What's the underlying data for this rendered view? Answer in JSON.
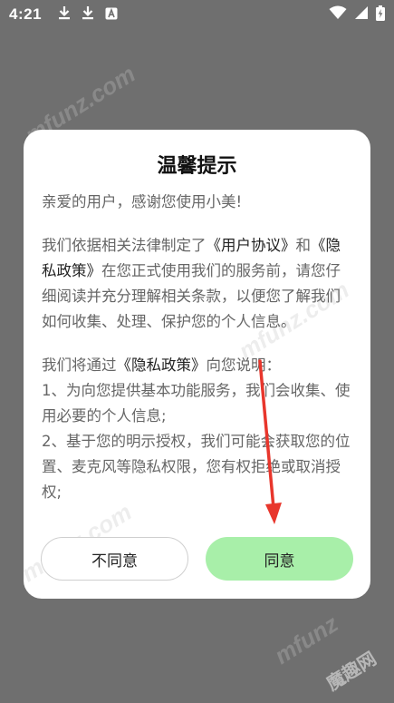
{
  "status_bar": {
    "time": "4:21",
    "icons": [
      "download-icon",
      "download-icon",
      "text-a-icon",
      "wifi-icon",
      "cellular-signal-icon",
      "battery-icon"
    ]
  },
  "dialog": {
    "title": "温馨提示",
    "greeting": "亲爱的用户，感谢您使用小美!",
    "para1_prefix": "我们依据相关法律制定了",
    "para1_link1": "《用户协议》",
    "para1_and": "和",
    "para1_link2": "《隐私政策》",
    "para1_suffix": "在您正式使用我们的服务前，请您仔细阅读并充分理解相关条款，以便您了解我们如何收集、处理、保护您的个人信息。",
    "para2_prefix": "我们将通过",
    "para2_link": "《隐私政策》",
    "para2_suffix": "向您说明：",
    "para2_item1": "1、为向您提供基本功能服务，我们会收集、使用必要的个人信息;",
    "para2_item2": "2、基于您的明示授权，我们可能会获取您的位置、麦克风等隐私权限，您有权拒绝或取消授权;",
    "decline_label": "不同意",
    "agree_label": "同意"
  },
  "watermarks": {
    "text": "mfunz.com",
    "corner_cn": "魔趣网",
    "corner_en": "mfunz"
  },
  "colors": {
    "overlay": "#6f6f6f",
    "agree_button": "#a8efa9",
    "annotation_arrow": "#e8362c"
  }
}
